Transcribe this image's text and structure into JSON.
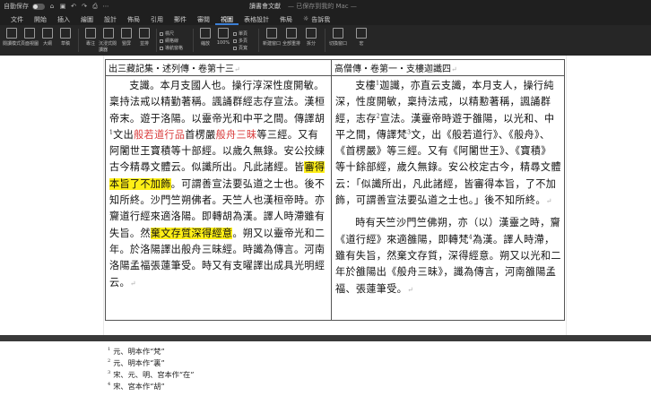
{
  "titlebar": {
    "autosave": "自動保存",
    "title": "讀書會文獻",
    "subtitle": "— 已保存到我的 Mac —"
  },
  "tabs": [
    "文件",
    "開始",
    "插入",
    "繪圖",
    "設計",
    "佈局",
    "引用",
    "郵件",
    "審閱",
    "視圖",
    "表格設計",
    "佈局",
    "告訴我"
  ],
  "ribbon": {
    "labels": [
      "閱讀模式",
      "頁面視圖",
      "大綱",
      "草稿",
      "專注",
      "沉浸式閱讀器",
      "豎屏",
      "並排",
      "縮放",
      "100%",
      "單頁",
      "多頁",
      "頁寬",
      "新建窗口",
      "全部重排",
      "拆分",
      "切換窗口",
      "宏"
    ],
    "checkboxes": [
      "標尺",
      "網格線",
      "導航窗格"
    ]
  },
  "document": {
    "left_header": "出三藏記集・述列傳・卷第十三",
    "right_header": "高僧傳・卷第一・支樓迦讖四",
    "left_body": {
      "part1": "支讖。本月支國人也。操行淳深性度開敏。稟持法戒以精勤著稱。諷誦群經志存宣法。漢桓帝末。遊于洛陽。以靈帝光和中平之間。傳譯胡",
      "sup1": "1",
      "part2": "文出",
      "red1": "般若道行品",
      "part3": "首楞嚴",
      "red2": "般舟三昧",
      "part4": "等三經。又有阿闍世王寶積等十部經。以歲久無錄。安公挍練古今精尋文體云。似讖所出。凡此諸經。皆",
      "hl1": "審得本旨了不加飾",
      "part5": "。可謂善宣法要弘道之士也。後不知所終。沙門竺朔佛者。天竺人也漢桓帝時。亦齎道行經來適洛陽。即轉胡為漢。譯人時滯雖有失旨。然",
      "hl2": "棄文存質深得經意",
      "part6": "。朔又以靈帝光和二年。於洛陽譯出般舟三昧經。時讖為傳言。河南洛陽孟福張蓮筆受。時又有支曜譯出成具光明經云。"
    },
    "right_body": {
      "p1a": "支樓",
      "sup_a": "1",
      "p1b": "迦讖，亦直云支讖，本月支人，操行純深，性度開敏，稟持法戒，以精懃著稱，諷誦群經，志存",
      "sup_b": "2",
      "p1c": "宣法。漢靈帝時遊于雒陽，以光和、中平之間，傳譯梵",
      "sup_c": "3",
      "p1d": "文，出《般若道行》、《般舟》、《首楞嚴》等三經。又有《阿闍世王》、《寶積》等十餘部經，歲久無錄。安公校定古今，精尋文體云：「似讖所出，凡此諸經，皆審得本旨，了不加飾，可謂善宣法要弘道之士也。」後不知所終。",
      "p2a": "時有天竺沙門竺佛朔，亦（以）漢靈之時，齎《道行經》來適雒陽，即轉梵",
      "sup_d": "4",
      "p2b": "為漢。譯人時滯，雖有失旨，然棄文存質，深得經意。朔又以光和二年於雒陽出《般舟三昧》，讖為傳言，河南雒陽孟福、張蓮筆受。"
    },
    "footnotes": [
      {
        "num": "1",
        "text": "元、明本作“梵”"
      },
      {
        "num": "2",
        "text": "元、明本作“裏”"
      },
      {
        "num": "3",
        "text": "宋、元、明、宮本作“在”"
      },
      {
        "num": "4",
        "text": "宋、宮本作“胡”"
      }
    ]
  },
  "colors": {
    "red_text": "#d93a3a",
    "highlight": "#ffef16",
    "active_tab_underline": "#3c7fd6"
  }
}
